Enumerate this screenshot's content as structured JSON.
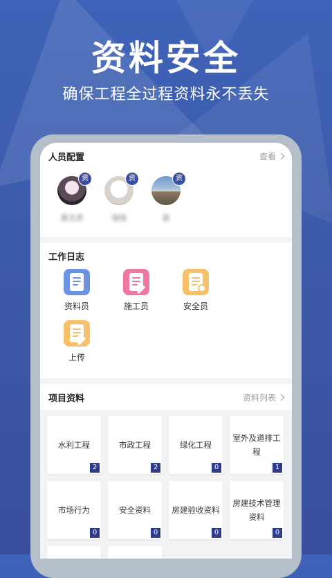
{
  "hero": {
    "title": "资料安全",
    "subtitle": "确保工程全过程资料永不丢失"
  },
  "personnel": {
    "title": "人员配置",
    "link": "查看",
    "people": [
      {
        "name": "莫文虎",
        "badge": "资",
        "avatar": "avatar-anime-girl"
      },
      {
        "name": "瑞瑞",
        "badge": "资",
        "avatar": "avatar-cat"
      },
      {
        "name": "骏",
        "badge": "资",
        "avatar": "avatar-landscape"
      }
    ]
  },
  "worklog": {
    "title": "工作日志",
    "items": [
      {
        "label": "资料员",
        "icon": "document-icon",
        "color": "#6c93e3"
      },
      {
        "label": "施工员",
        "icon": "document-wrench-icon",
        "color": "#f078a0"
      },
      {
        "label": "安全员",
        "icon": "document-shield-icon",
        "color": "#f6c16a"
      },
      {
        "label": "上传",
        "icon": "document-edit-icon",
        "color": "#f6c16a"
      }
    ]
  },
  "projects": {
    "title": "项目资料",
    "link": "资料列表",
    "tiles": [
      {
        "label": "水利工程",
        "count": "2"
      },
      {
        "label": "市政工程",
        "count": "2"
      },
      {
        "label": "绿化工程",
        "count": "0"
      },
      {
        "label": "室外及道排工程",
        "count": "1"
      },
      {
        "label": "市场行为",
        "count": "0"
      },
      {
        "label": "安全资料",
        "count": "0"
      },
      {
        "label": "房建验收资料",
        "count": "0"
      },
      {
        "label": "房建技术管理资料",
        "count": "0"
      }
    ]
  },
  "colors": {
    "background": "#3f5fb3",
    "accent": "#2e3a8c",
    "badge": "#3a4ea5"
  }
}
